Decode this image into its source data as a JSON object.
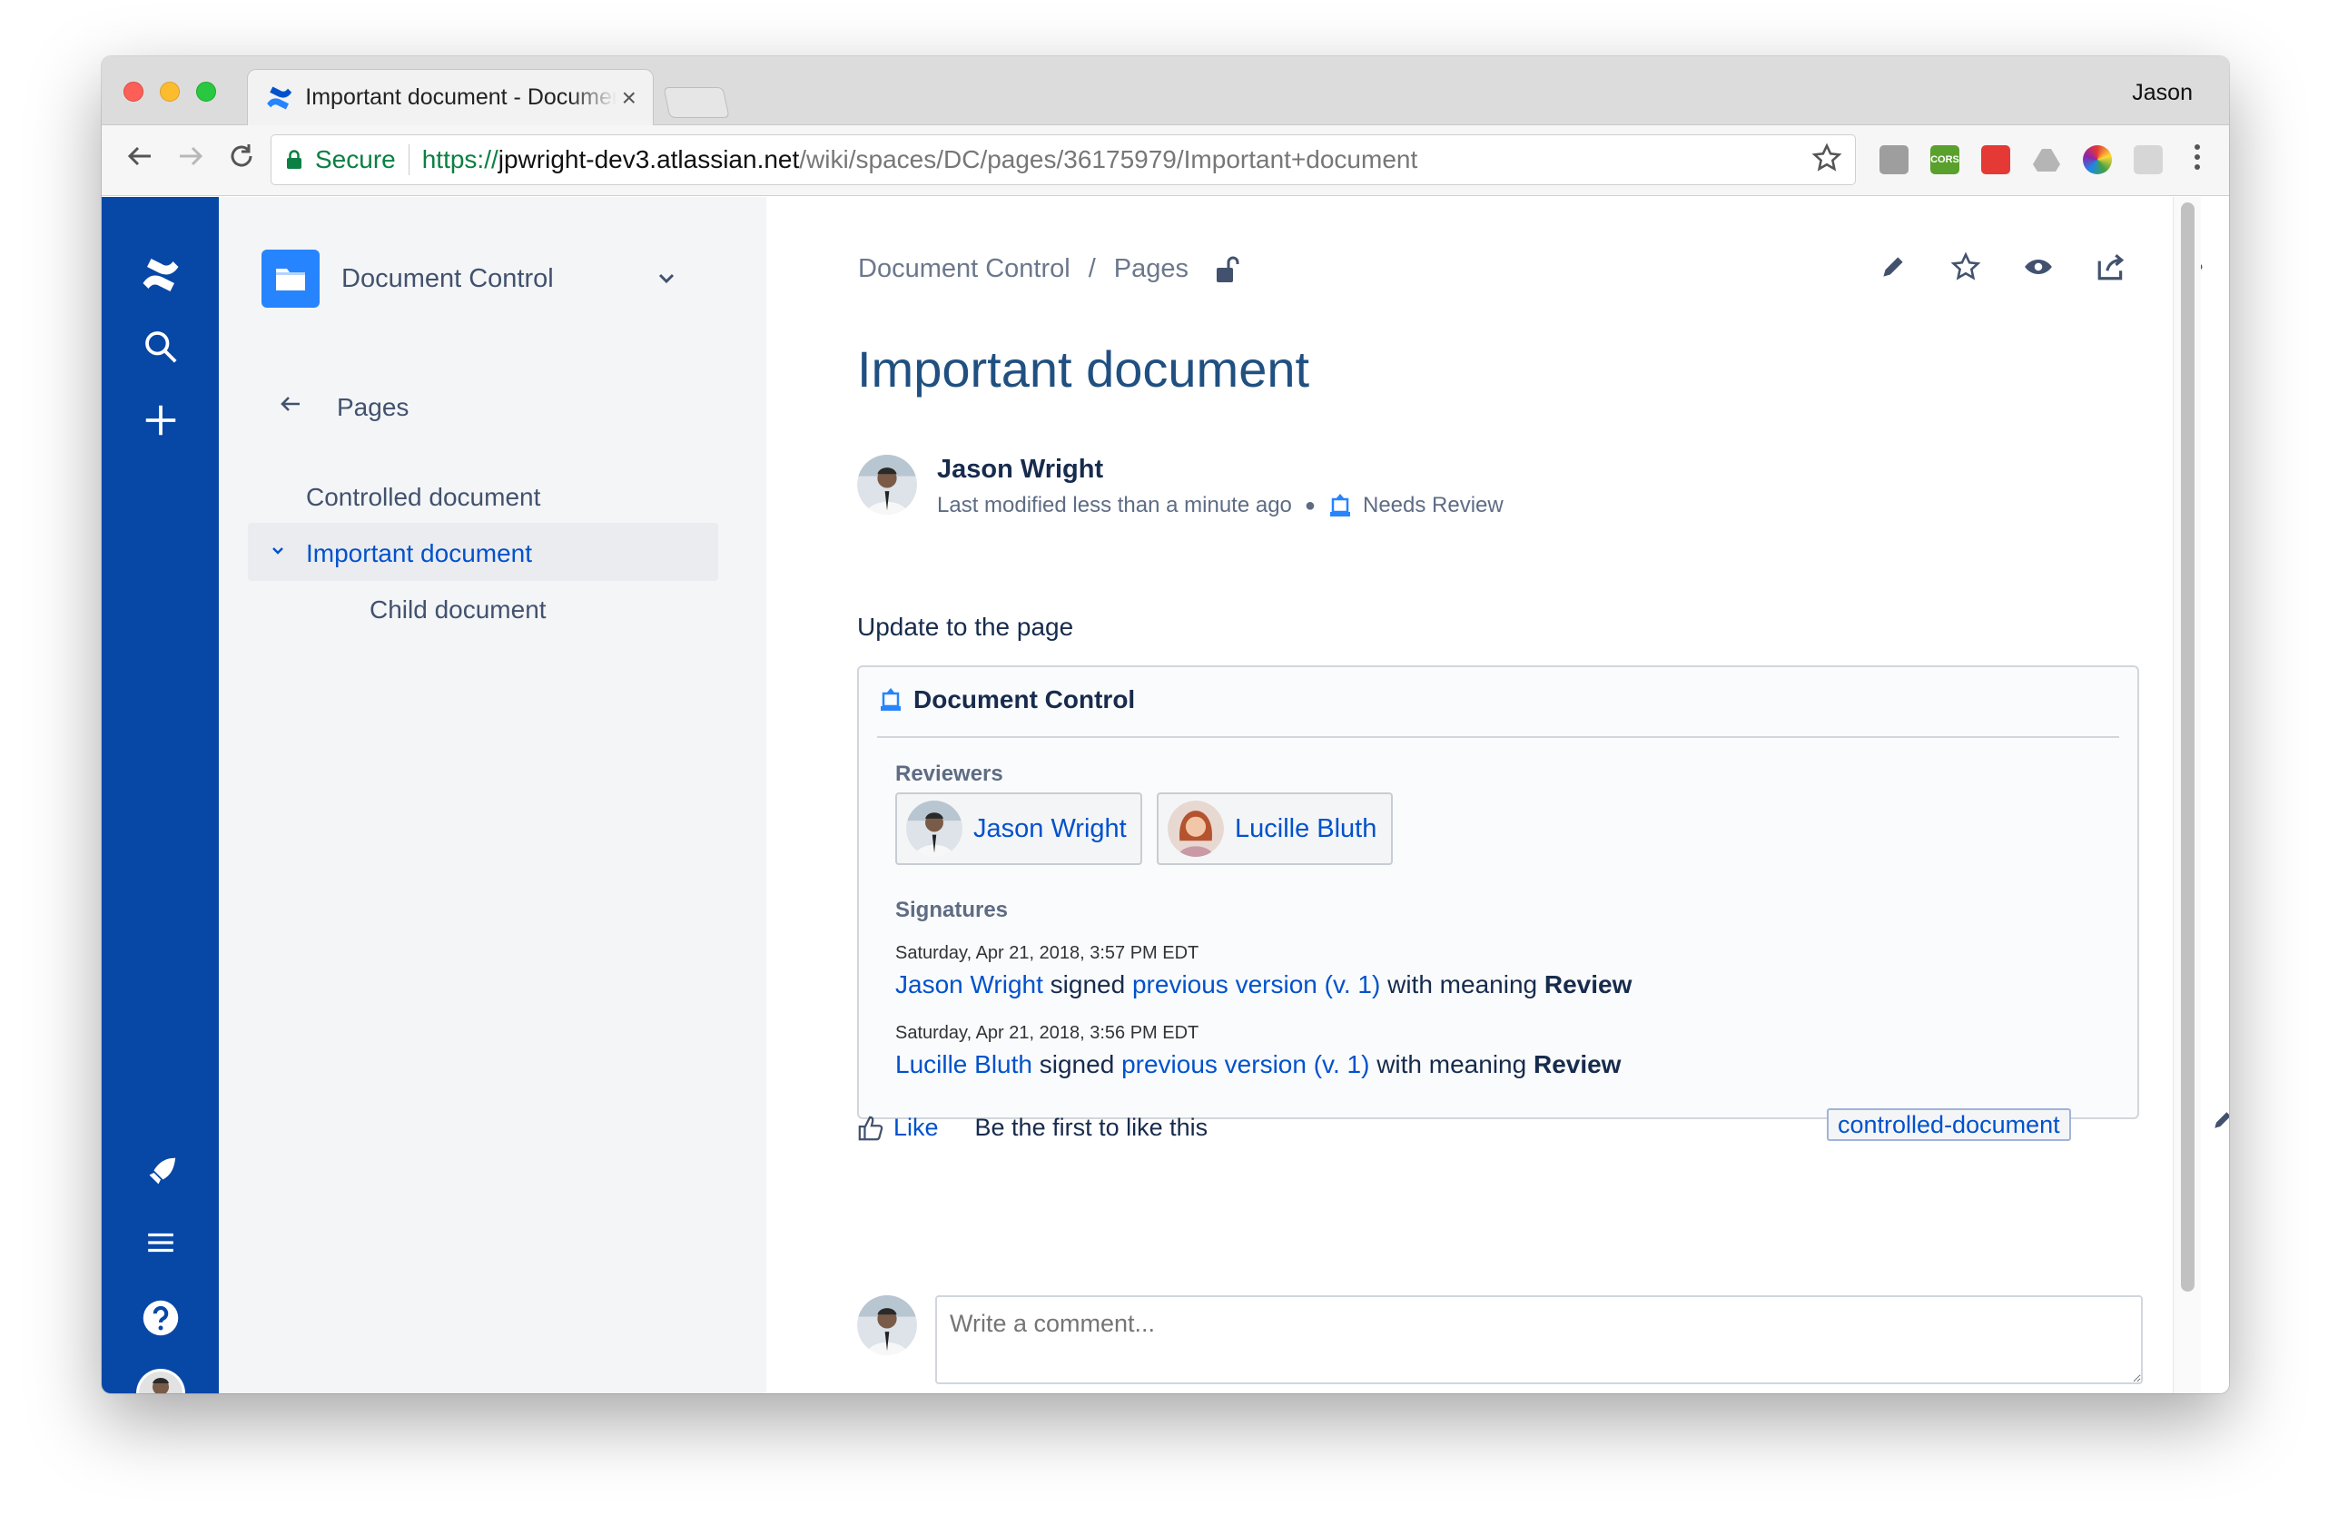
{
  "browser": {
    "tab_title": "Important document - Document Control",
    "tab_close": "×",
    "profile_name": "Jason",
    "secure_label": "Secure",
    "url_scheme": "https://",
    "url_host": "jpwright-dev3.atlassian.net",
    "url_path": "/wiki/spaces/DC/pages/36175979/Important+document",
    "ext_cors_label": "CORS"
  },
  "sidebar": {
    "space_name": "Document Control",
    "back_label": "Pages",
    "tree": [
      {
        "label": "Controlled document"
      },
      {
        "label": "Important document"
      },
      {
        "label": "Child document"
      }
    ]
  },
  "page": {
    "breadcrumb": [
      "Document Control",
      "Pages"
    ],
    "breadcrumb_sep": "/",
    "title": "Important document",
    "author": "Jason Wright",
    "last_modified": "Last modified less than a minute ago",
    "status": "Needs Review",
    "body": "Update to the page"
  },
  "doc_control": {
    "heading": "Document Control",
    "reviewers_label": "Reviewers",
    "reviewers": [
      {
        "name": "Jason Wright"
      },
      {
        "name": "Lucille Bluth"
      }
    ],
    "signatures_label": "Signatures",
    "signatures": [
      {
        "date": "Saturday, Apr 21, 2018, 3:57 PM EDT",
        "name": "Jason Wright",
        "verb": "signed",
        "link": "previous version (v. 1)",
        "meaning_text": "with meaning",
        "meaning": "Review"
      },
      {
        "date": "Saturday, Apr 21, 2018, 3:56 PM EDT",
        "name": "Lucille Bluth",
        "verb": "signed",
        "link": "previous version (v. 1)",
        "meaning_text": "with meaning",
        "meaning": "Review"
      }
    ]
  },
  "footer": {
    "like_label": "Like",
    "like_text": "Be the first to like this",
    "label_tag": "controlled-document",
    "comment_placeholder": "Write a comment..."
  },
  "colors": {
    "global_nav": "#0747a6",
    "link": "#0052cc",
    "title": "#205081",
    "sidebar_bg": "#f4f5f7"
  }
}
